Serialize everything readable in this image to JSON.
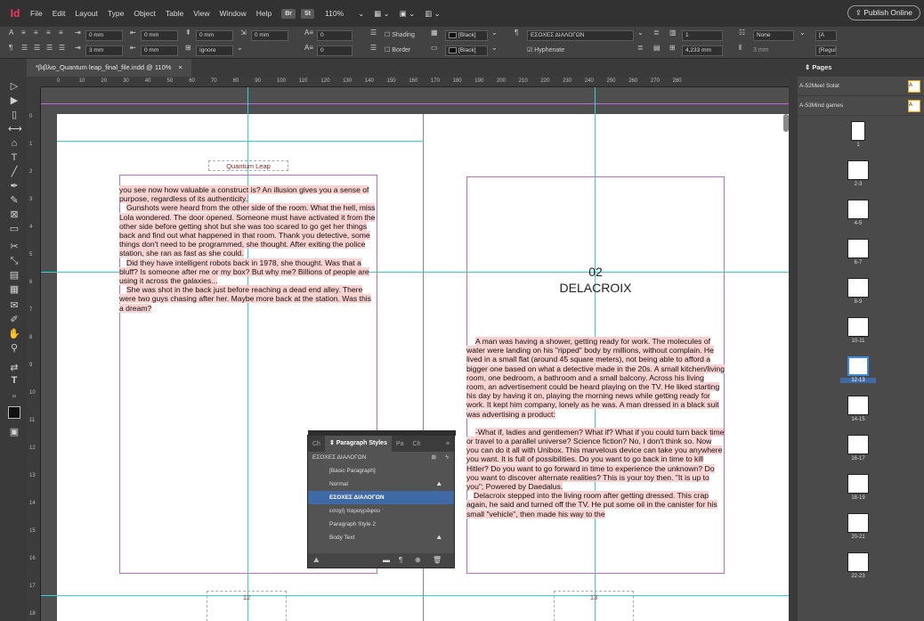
{
  "menubar": {
    "app_logo": "Id",
    "items": [
      "File",
      "Edit",
      "Layout",
      "Type",
      "Object",
      "Table",
      "View",
      "Window",
      "Help"
    ],
    "chip_br": "Br",
    "chip_st": "St",
    "zoom": "110%",
    "publish": "Publish Online"
  },
  "control": {
    "indent_left": "0 mm",
    "indent_right": "0 mm",
    "first_line": "0 mm",
    "last_line": "0 mm",
    "space_before": "0 mm",
    "space_after": "3 mm",
    "space_after2": "0 mm",
    "drop_cap_lines": "0",
    "drop_cap_chars": "0",
    "align_to": "Ignore",
    "shading": "Shading",
    "border": "Border",
    "color1": "[Black]",
    "color2": "[Black]",
    "para_style": "ΕΣΟΧΕΣ ΔΙΑΛΟΓΩΝ",
    "hyphenate": "Hyphenate",
    "columns": "1",
    "col_width": "4,233 mm",
    "none": "None",
    "gutter": "3 mm",
    "font_hint": "[A",
    "style_hint": "[Regul"
  },
  "document": {
    "tab_title": "*βιβλιο_Quantum leap_final_file.indd @ 110%",
    "close": "×"
  },
  "ruler_h": [
    "0",
    "10",
    "20",
    "30",
    "40",
    "50",
    "60",
    "70",
    "80",
    "90",
    "100",
    "110",
    "120",
    "130",
    "140",
    "150",
    "160",
    "170",
    "180",
    "190",
    "200",
    "210",
    "220",
    "230",
    "240",
    "250",
    "260",
    "270",
    "280"
  ],
  "ruler_v": [
    "0",
    "1",
    "2",
    "3",
    "4",
    "5",
    "6",
    "7",
    "8",
    "9",
    "10",
    "11",
    "12",
    "13",
    "14",
    "15",
    "16",
    "17",
    "18"
  ],
  "left_page": {
    "running_head": "Quantum Leap",
    "paragraphs": [
      "you see now how valuable a construct is? An illusion gives you a sense of purpose, regardless of its authenticity.",
      "Gunshots were heard from the other side of the room. What the hell, miss Lola wondered. The door opened. Someone must have activated it from the other side before getting shot but she was too scared to go get her things back and find out what happened in that room. Thank you detective, some things don't need to be programmed, she thought. After exiting the police station, she ran as fast as she could.",
      "Did they have intelligent robots back in 1978, she thought. Was that a bluff? Is someone after me or my box? But why me? Billions of people are using it across the galaxies...",
      "She was shot in the back just before reaching a dead end alley. There were two guys chasing after her. Maybe more back at the station. Was this a dream?"
    ],
    "page_number": "12"
  },
  "right_page": {
    "chapter_number": "02",
    "chapter_title": "DELACROIX",
    "paragraphs": [
      "A man was having a shower, getting ready for work. The molecules of water were landing on his \"ripped\" body by millions, without complain. He lived in a small flat (around 45 square meters), not being able to afford a bigger one based on what a detective made in the 20s. A small kitchen/living room, one bedroom, a bathroom and a small balcony. Across his living room, an advertisement could be heard playing on the TV. He liked starting his day by having it on, playing the morning news while getting ready for work. It kept him company, lonely as he was. A man dressed in a black suit was advertising a product:",
      "-What if, ladies and gentlemen? What if? What if you could turn back time or travel to a parallel universe? Science fiction? No, I don't think so. Now you can do it all with Unibox. This marvelous device can take you anywhere you want. It is full of possibilities. Do you want to go back in time to kill Hitler? Do you want to go forward in time to experience the unknown? Do you want to discover alternate realities? This is your toy then. \"It is up to you\"; Powered by Daedalus.",
      "Delacroix stepped into the living room after getting dressed. This crap again, he said and turned off the TV. He put some oil in the canister for his small \"vehicle\", then made his way to the"
    ],
    "page_number": "13"
  },
  "para_panel": {
    "tabs": [
      "Ch",
      "Paragraph Styles",
      "Pa",
      "Ch"
    ],
    "current": "ΕΣΟΧΕΣ ΔΙΑΛΟΓΩΝ",
    "styles": [
      "[Basic Paragraph]",
      "Normal",
      "ΕΣΟΧΕΣ ΔΙΑΛΟΓΩΝ",
      "εσοχή παραγράφου",
      "Paragraph Style 2",
      "Body Text"
    ],
    "selected_index": 2
  },
  "pages_panel": {
    "title": "Pages",
    "masters": [
      "A-52Meet Solat",
      "A-53Mind games"
    ],
    "spreads": [
      "1",
      "2-3",
      "4-5",
      "6-7",
      "8-9",
      "10-11",
      "12-13",
      "14-15",
      "16-17",
      "18-19",
      "20-21",
      "22-23"
    ],
    "current_spread": "12-13"
  }
}
